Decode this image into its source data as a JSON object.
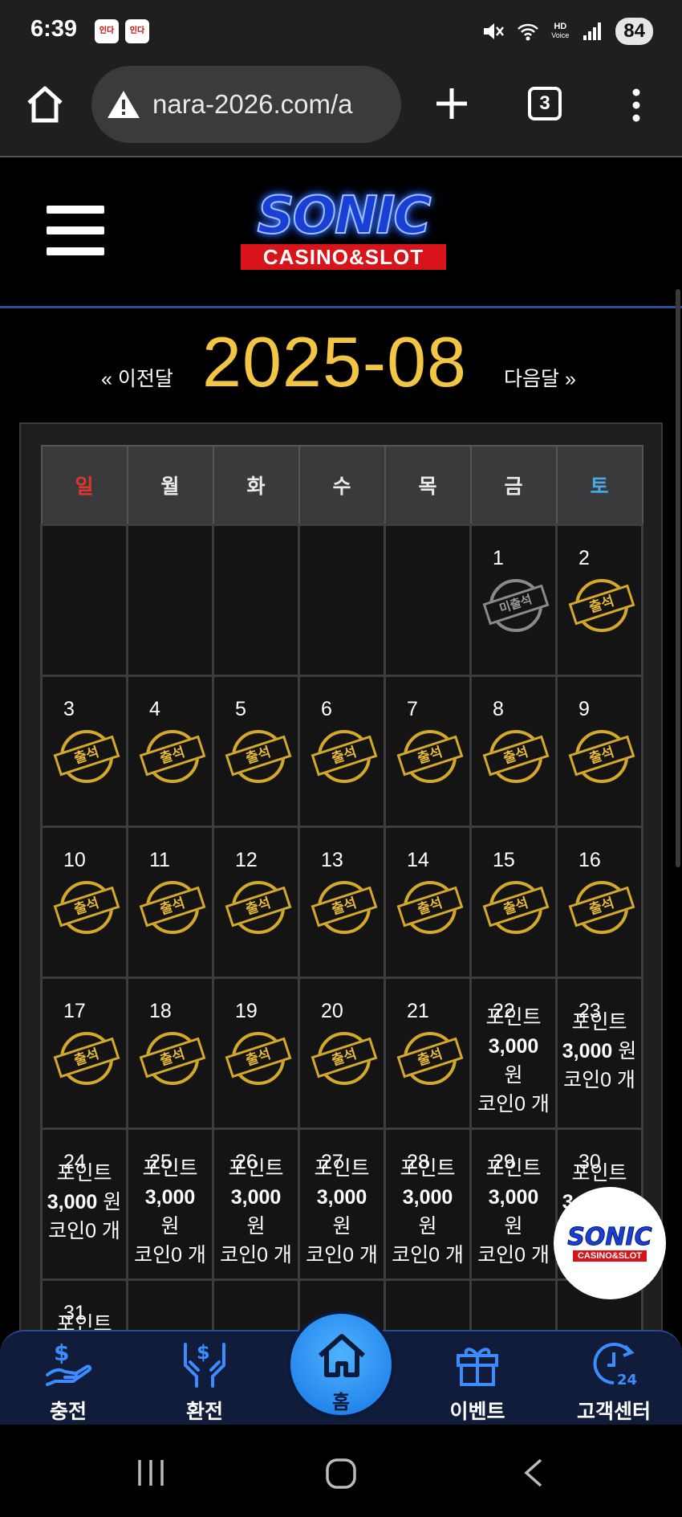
{
  "status_bar": {
    "time": "6:39",
    "notif_label": "인다",
    "hd_label": "HD",
    "voice_label": "Voice",
    "battery": "84"
  },
  "browser": {
    "url": "nara-2026.com/a",
    "tab_count": "3"
  },
  "header": {
    "logo_main": "SONIC",
    "logo_sub": "CASINO&SLOT"
  },
  "month_nav": {
    "prev_label": "« 이전달",
    "title": "2025-08",
    "next_label": "다음달 »"
  },
  "calendar": {
    "weekdays": [
      "일",
      "월",
      "화",
      "수",
      "목",
      "금",
      "토"
    ],
    "stamp_attended": "출석",
    "stamp_absent": "미출석",
    "reward_point_label": "포인트",
    "reward_amount": "3,000",
    "reward_unit": "원",
    "reward_coin": "코인0 개"
  },
  "float_logo": {
    "main": "SONIC",
    "sub": "CASINO&SLOT"
  },
  "bottom_nav": {
    "charge": "충전",
    "exchange": "환전",
    "home": "홈",
    "event": "이벤트",
    "support": "고객센터"
  }
}
